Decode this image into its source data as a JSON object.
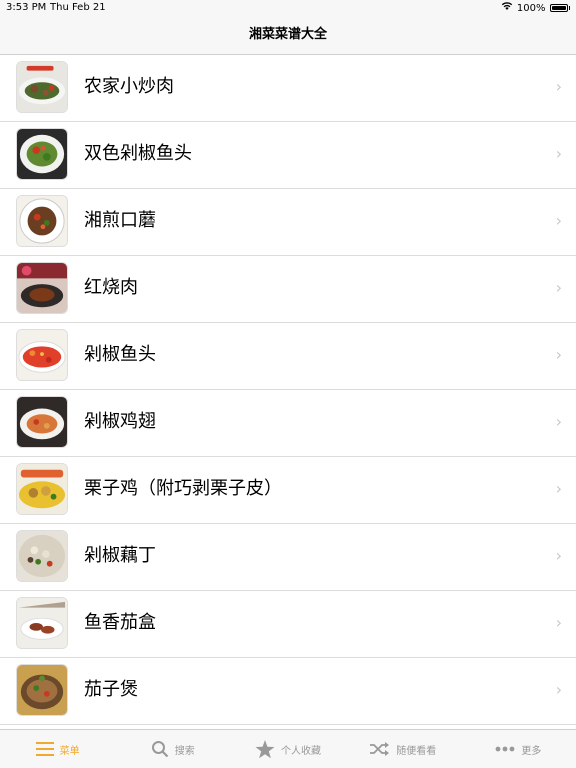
{
  "status": {
    "time": "3:53 PM",
    "date": "Thu Feb 21",
    "battery": "100%"
  },
  "header": {
    "title": "湘菜菜谱大全"
  },
  "recipes": [
    {
      "name": "农家小炒肉"
    },
    {
      "name": "双色剁椒鱼头"
    },
    {
      "name": "湘煎口蘑"
    },
    {
      "name": "红烧肉"
    },
    {
      "name": "剁椒鱼头"
    },
    {
      "name": "剁椒鸡翅"
    },
    {
      "name": "栗子鸡（附巧剥栗子皮）"
    },
    {
      "name": "剁椒藕丁"
    },
    {
      "name": "鱼香茄盒"
    },
    {
      "name": "茄子煲"
    }
  ],
  "tabs": [
    {
      "label": "菜单",
      "icon": "menu-icon",
      "active": true
    },
    {
      "label": "搜索",
      "icon": "search-icon",
      "active": false
    },
    {
      "label": "个人收藏",
      "icon": "star-icon",
      "active": false
    },
    {
      "label": "随便看看",
      "icon": "shuffle-icon",
      "active": false
    },
    {
      "label": "更多",
      "icon": "more-icon",
      "active": false
    }
  ],
  "colors": {
    "accent": "#f0a830",
    "inactive": "#999999"
  }
}
